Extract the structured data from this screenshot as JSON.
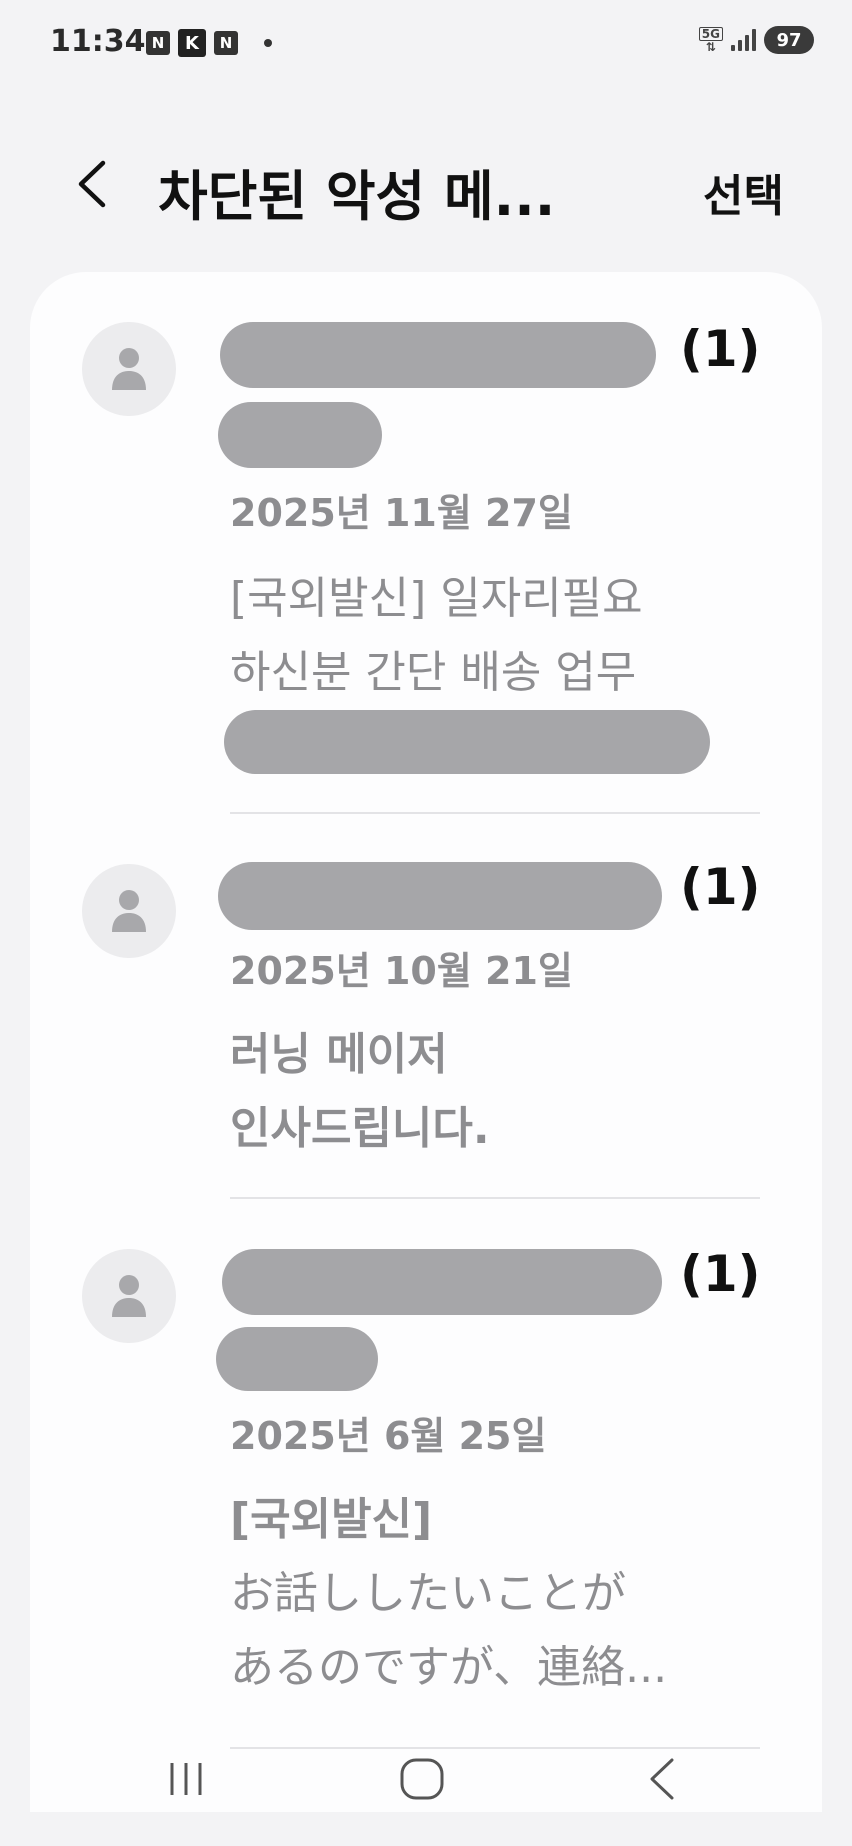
{
  "status_bar": {
    "time": "11:34",
    "notif_icons": [
      "N",
      "K",
      "N"
    ],
    "network": "5G",
    "battery": "97"
  },
  "header": {
    "title": "차단된 악성 메...",
    "select_label": "선택"
  },
  "messages": [
    {
      "count": "(1)",
      "date": "2025년 11월 27일",
      "preview_lines": [
        "[국외발신] 일자리필요",
        "하신분 간단 배송 업무"
      ]
    },
    {
      "count": "(1)",
      "date": "2025년 10월 21일",
      "preview_lines": [
        "러닝 메이저",
        "인사드립니다."
      ]
    },
    {
      "count": "(1)",
      "date": "2025년 6월 25일",
      "preview_lines": [
        "[국외발신]",
        "お話ししたいことが",
        "あるのですが、連絡..."
      ]
    }
  ],
  "nav_bar": {
    "icons": [
      "recent-apps-icon",
      "home-icon",
      "back-icon"
    ]
  }
}
